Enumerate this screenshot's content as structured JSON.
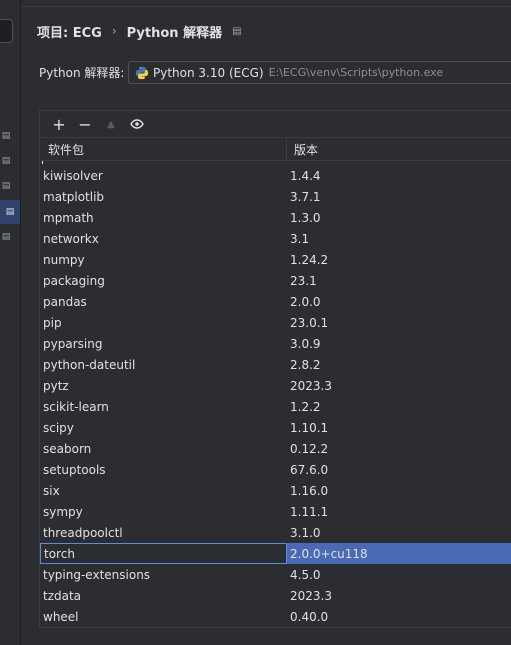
{
  "breadcrumb": {
    "project": "项目: ECG",
    "separator": "›",
    "page": "Python 解释器"
  },
  "interpreter": {
    "label": "Python 解释器:",
    "name": "Python 3.10 (ECG)",
    "path": "E:\\ECG\\venv\\Scripts\\python.exe"
  },
  "toolbar": {
    "add": "+",
    "remove": "−",
    "upgrade": "▲",
    "show": "👁"
  },
  "table": {
    "headers": {
      "name": "软件包",
      "version": "版本"
    },
    "rows": [
      {
        "name": "kiwisolver",
        "version": "1.4.4"
      },
      {
        "name": "matplotlib",
        "version": "3.7.1"
      },
      {
        "name": "mpmath",
        "version": "1.3.0"
      },
      {
        "name": "networkx",
        "version": "3.1"
      },
      {
        "name": "numpy",
        "version": "1.24.2"
      },
      {
        "name": "packaging",
        "version": "23.1"
      },
      {
        "name": "pandas",
        "version": "2.0.0"
      },
      {
        "name": "pip",
        "version": "23.0.1"
      },
      {
        "name": "pyparsing",
        "version": "3.0.9"
      },
      {
        "name": "python-dateutil",
        "version": "2.8.2"
      },
      {
        "name": "pytz",
        "version": "2023.3"
      },
      {
        "name": "scikit-learn",
        "version": "1.2.2"
      },
      {
        "name": "scipy",
        "version": "1.10.1"
      },
      {
        "name": "seaborn",
        "version": "0.12.2"
      },
      {
        "name": "setuptools",
        "version": "67.6.0"
      },
      {
        "name": "six",
        "version": "1.16.0"
      },
      {
        "name": "sympy",
        "version": "1.11.1"
      },
      {
        "name": "threadpoolctl",
        "version": "3.1.0"
      },
      {
        "name": "torch",
        "version": "2.0.0+cu118"
      },
      {
        "name": "typing-extensions",
        "version": "4.5.0"
      },
      {
        "name": "tzdata",
        "version": "2023.3"
      },
      {
        "name": "wheel",
        "version": "0.40.0"
      }
    ],
    "selected_index": 18
  },
  "colors": {
    "background": "#2b2d30",
    "selection": "#2e436e",
    "selection_cell": "#4a6ab5",
    "text": "#dfe1e5"
  }
}
